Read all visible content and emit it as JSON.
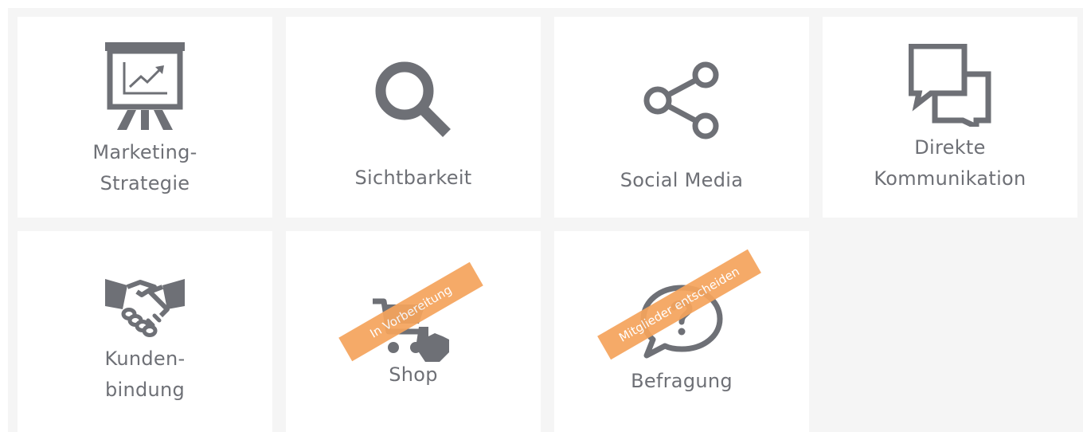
{
  "tiles": {
    "marketing": {
      "line1": "Marketing-",
      "line2": "Strategie"
    },
    "visibility": {
      "label": "Sichtbarkeit"
    },
    "social": {
      "label": "Social Media"
    },
    "communication": {
      "line1": "Direkte",
      "line2": "Kommunikation"
    },
    "loyalty": {
      "line1": "Kunden-",
      "line2": "bindung"
    },
    "shop": {
      "label": "Shop",
      "ribbon": "In Vorbereitung"
    },
    "survey": {
      "label": "Befragung",
      "ribbon": "Mitglieder entscheiden"
    }
  },
  "icons": {
    "marketing": "presentation-chart-icon",
    "visibility": "magnifier-icon",
    "social": "share-icon",
    "communication": "chat-bubbles-icon",
    "loyalty": "handshake-icon",
    "shop": "shopping-cart-hand-icon",
    "survey": "speech-bubble-question-icon"
  },
  "colors": {
    "icon": "#6e7076",
    "label": "#6e7076",
    "ribbon": "#f5a45d",
    "tile": "#ffffff",
    "background": "#f5f5f5"
  }
}
